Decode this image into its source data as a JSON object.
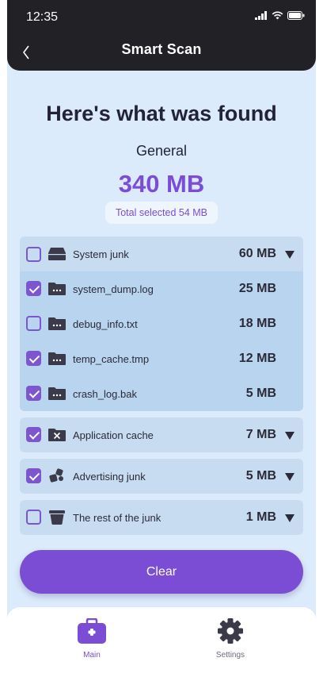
{
  "status_bar": {
    "time": "12:35"
  },
  "nav": {
    "title": "Smart Scan"
  },
  "summary": {
    "heading": "Here's what was found",
    "category": "General",
    "total": "340 MB",
    "selected": "Total selected 54 MB"
  },
  "groups": [
    {
      "label": "System junk",
      "size": "60 MB",
      "checked": false,
      "icon": "drive-icon",
      "expanded": true,
      "items": [
        {
          "label": "system_dump.log",
          "size": "25 MB",
          "checked": true,
          "icon": "folder-icon"
        },
        {
          "label": "debug_info.txt",
          "size": "18 MB",
          "checked": false,
          "icon": "folder-icon"
        },
        {
          "label": "temp_cache.tmp",
          "size": "12 MB",
          "checked": true,
          "icon": "folder-icon"
        },
        {
          "label": "crash_log.bak",
          "size": "5 MB",
          "checked": true,
          "icon": "folder-icon"
        }
      ]
    },
    {
      "label": "Application cache",
      "size": "7 MB",
      "checked": true,
      "icon": "close-box-icon",
      "expanded": false
    },
    {
      "label": "Advertising junk",
      "size": "5 MB",
      "checked": true,
      "icon": "puzzle-icon",
      "expanded": false
    },
    {
      "label": "The rest of the junk",
      "size": "1 MB",
      "checked": false,
      "icon": "trash-icon",
      "expanded": false
    }
  ],
  "actions": {
    "clear_label": "Clear"
  },
  "tabbar": {
    "main_label": "Main",
    "settings_label": "Settings"
  },
  "colors": {
    "accent": "#7b4dd4",
    "topbar": "#222226",
    "background": "#dcebfb"
  }
}
